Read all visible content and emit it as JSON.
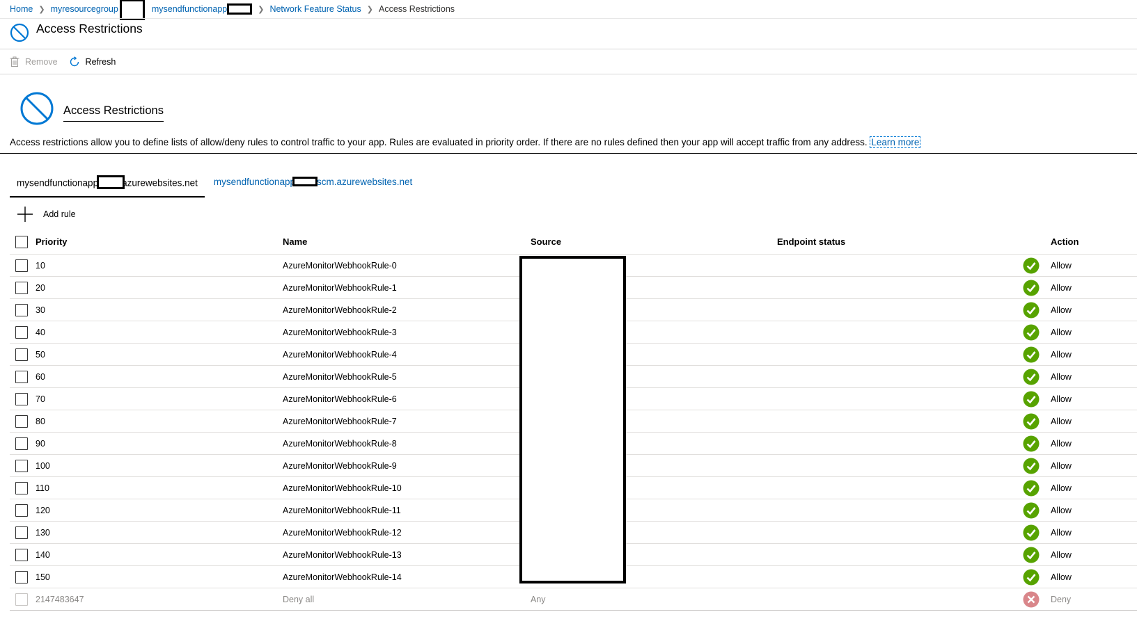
{
  "breadcrumb": {
    "items": [
      "Home",
      "myresourcegroup",
      "mysendfunctionapp",
      "Network Feature Status"
    ],
    "current": "Access Restrictions"
  },
  "blade": {
    "title": "Access Restrictions",
    "icon": "blocked-circle-icon"
  },
  "toolbar": {
    "remove_label": "Remove",
    "refresh_label": "Refresh"
  },
  "section": {
    "title": "Access Restrictions",
    "description": "Access restrictions allow you to define lists of allow/deny rules to control traffic to your app. Rules are evaluated in priority order. If there are no rules defined then your app will accept traffic from any address.",
    "learn_more": "Learn more"
  },
  "tabs": {
    "main": {
      "prefix": "mysendfunctionapp",
      "suffix": "azurewebsites.net"
    },
    "scm": {
      "prefix": "mysendfunctionapp",
      "suffix": "scm.azurewebsites.net"
    }
  },
  "add_rule_label": "Add rule",
  "table": {
    "columns": [
      "Priority",
      "Name",
      "Source",
      "Endpoint status",
      "Action"
    ],
    "rows": [
      {
        "priority": "10",
        "name": "AzureMonitorWebhookRule-0",
        "source": "",
        "endpoint": "",
        "action": "Allow"
      },
      {
        "priority": "20",
        "name": "AzureMonitorWebhookRule-1",
        "source": "",
        "endpoint": "",
        "action": "Allow"
      },
      {
        "priority": "30",
        "name": "AzureMonitorWebhookRule-2",
        "source": "",
        "endpoint": "",
        "action": "Allow"
      },
      {
        "priority": "40",
        "name": "AzureMonitorWebhookRule-3",
        "source": "",
        "endpoint": "",
        "action": "Allow"
      },
      {
        "priority": "50",
        "name": "AzureMonitorWebhookRule-4",
        "source": "",
        "endpoint": "",
        "action": "Allow"
      },
      {
        "priority": "60",
        "name": "AzureMonitorWebhookRule-5",
        "source": "",
        "endpoint": "",
        "action": "Allow"
      },
      {
        "priority": "70",
        "name": "AzureMonitorWebhookRule-6",
        "source": "",
        "endpoint": "",
        "action": "Allow"
      },
      {
        "priority": "80",
        "name": "AzureMonitorWebhookRule-7",
        "source": "",
        "endpoint": "",
        "action": "Allow"
      },
      {
        "priority": "90",
        "name": "AzureMonitorWebhookRule-8",
        "source": "",
        "endpoint": "",
        "action": "Allow"
      },
      {
        "priority": "100",
        "name": "AzureMonitorWebhookRule-9",
        "source": "",
        "endpoint": "",
        "action": "Allow"
      },
      {
        "priority": "110",
        "name": "AzureMonitorWebhookRule-10",
        "source": "",
        "endpoint": "",
        "action": "Allow"
      },
      {
        "priority": "120",
        "name": "AzureMonitorWebhookRule-11",
        "source": "",
        "endpoint": "",
        "action": "Allow"
      },
      {
        "priority": "130",
        "name": "AzureMonitorWebhookRule-12",
        "source": "",
        "endpoint": "",
        "action": "Allow"
      },
      {
        "priority": "140",
        "name": "AzureMonitorWebhookRule-13",
        "source": "",
        "endpoint": "",
        "action": "Allow"
      },
      {
        "priority": "150",
        "name": "AzureMonitorWebhookRule-14",
        "source": "",
        "endpoint": "",
        "action": "Allow"
      },
      {
        "priority": "2147483647",
        "name": "Deny all",
        "source": "Any",
        "endpoint": "",
        "action": "Deny"
      }
    ]
  },
  "colors": {
    "link": "#0063b1",
    "allow_icon": "#57a300",
    "deny_icon": "#d9868a",
    "blocked_icon": "#0078d4"
  }
}
